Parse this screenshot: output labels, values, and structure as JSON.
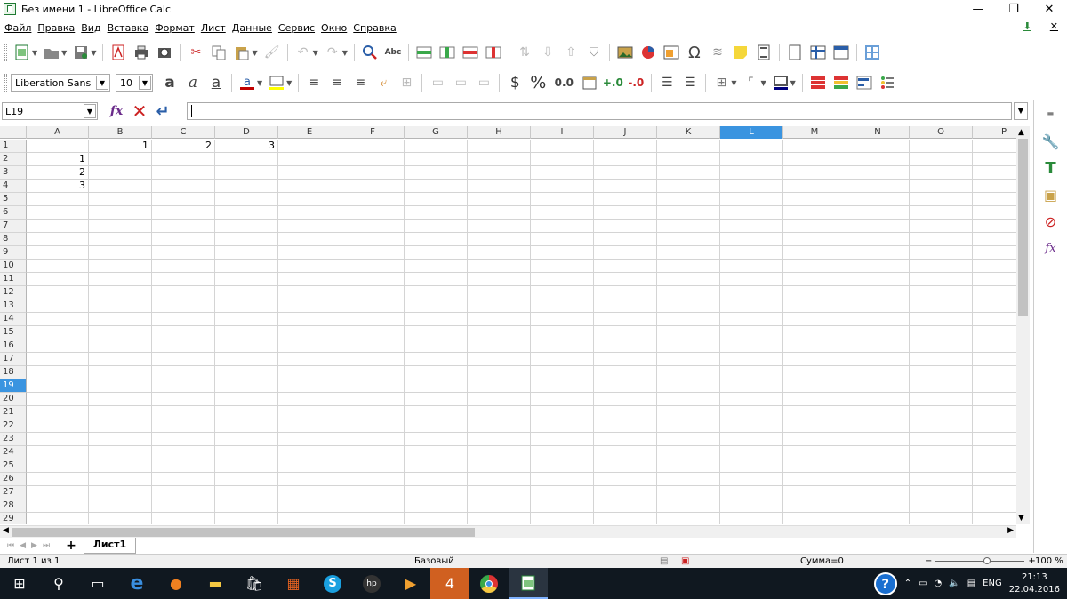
{
  "window": {
    "title": "Без имени 1 - LibreOffice Calc",
    "min": "—",
    "restore": "❐",
    "close": "✕"
  },
  "menu": [
    "Файл",
    "Правка",
    "Вид",
    "Вставка",
    "Формат",
    "Лист",
    "Данные",
    "Сервис",
    "Окно",
    "Справка"
  ],
  "format_bar": {
    "font_name": "Liberation Sans",
    "font_size": "10",
    "currency": "$",
    "percent": "%",
    "number": "0.0"
  },
  "formula_bar": {
    "cell_ref": "L19",
    "content": ""
  },
  "columns": [
    "A",
    "B",
    "C",
    "D",
    "E",
    "F",
    "G",
    "H",
    "I",
    "J",
    "K",
    "L",
    "M",
    "N",
    "O",
    "P"
  ],
  "selected_column": "L",
  "selected_row": 19,
  "rows": [
    {
      "n": "1",
      "cells": {
        "B": "1",
        "C": "2",
        "D": "3"
      }
    },
    {
      "n": "2",
      "cells": {
        "A": "1"
      }
    },
    {
      "n": "3",
      "cells": {
        "A": "2"
      }
    },
    {
      "n": "4",
      "cells": {
        "A": "3"
      }
    },
    {
      "n": "5",
      "cells": {}
    },
    {
      "n": "6",
      "cells": {}
    },
    {
      "n": "7",
      "cells": {}
    },
    {
      "n": "8",
      "cells": {}
    },
    {
      "n": "9",
      "cells": {}
    },
    {
      "n": "10",
      "cells": {}
    },
    {
      "n": "11",
      "cells": {}
    },
    {
      "n": "12",
      "cells": {}
    },
    {
      "n": "13",
      "cells": {}
    },
    {
      "n": "14",
      "cells": {}
    },
    {
      "n": "15",
      "cells": {}
    },
    {
      "n": "16",
      "cells": {}
    },
    {
      "n": "17",
      "cells": {}
    },
    {
      "n": "18",
      "cells": {}
    },
    {
      "n": "19",
      "cells": {}
    },
    {
      "n": "20",
      "cells": {}
    },
    {
      "n": "21",
      "cells": {}
    },
    {
      "n": "22",
      "cells": {}
    },
    {
      "n": "23",
      "cells": {}
    },
    {
      "n": "24",
      "cells": {}
    },
    {
      "n": "25",
      "cells": {}
    },
    {
      "n": "26",
      "cells": {}
    },
    {
      "n": "27",
      "cells": {}
    },
    {
      "n": "28",
      "cells": {}
    },
    {
      "n": "29",
      "cells": {}
    }
  ],
  "sheet": {
    "tab": "Лист1",
    "add": "+"
  },
  "status": {
    "sheet_info": "Лист 1 из 1",
    "style": "Базовый",
    "sum": "Сумма=0",
    "zoom": "100 %"
  },
  "taskbar": {
    "lang": "ENG",
    "time": "21:13",
    "date": "22.04.2016",
    "help": "?"
  },
  "colors": {
    "accent": "#3a94e0",
    "taskbar": "#101820"
  }
}
